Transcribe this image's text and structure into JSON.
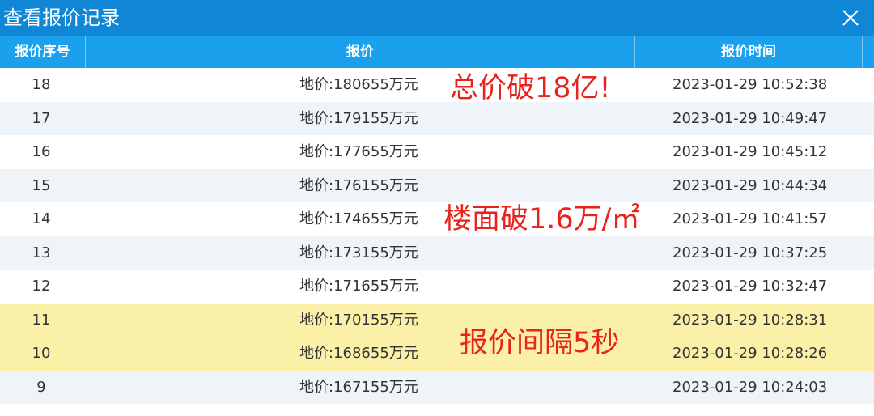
{
  "window": {
    "title": "查看报价记录"
  },
  "table": {
    "headers": {
      "seq": "报价序号",
      "price": "报价",
      "time": "报价时间"
    },
    "rows": [
      {
        "seq": "18",
        "price": "地价:180655万元",
        "time": "2023-01-29 10:52:38"
      },
      {
        "seq": "17",
        "price": "地价:179155万元",
        "time": "2023-01-29 10:49:47"
      },
      {
        "seq": "16",
        "price": "地价:177655万元",
        "time": "2023-01-29 10:45:12"
      },
      {
        "seq": "15",
        "price": "地价:176155万元",
        "time": "2023-01-29 10:44:34"
      },
      {
        "seq": "14",
        "price": "地价:174655万元",
        "time": "2023-01-29 10:41:57"
      },
      {
        "seq": "13",
        "price": "地价:173155万元",
        "time": "2023-01-29 10:37:25"
      },
      {
        "seq": "12",
        "price": "地价:171655万元",
        "time": "2023-01-29 10:32:47"
      },
      {
        "seq": "11",
        "price": "地价:170155万元",
        "time": "2023-01-29 10:28:31"
      },
      {
        "seq": "10",
        "price": "地价:168655万元",
        "time": "2023-01-29 10:28:26"
      },
      {
        "seq": "9",
        "price": "地价:167155万元",
        "time": "2023-01-29 10:24:03"
      }
    ]
  },
  "annotations": {
    "a1": "总价破18亿!",
    "a2": "楼面破1.6万/㎡",
    "a3": "报价间隔5秒"
  },
  "colors": {
    "titlebar": "#0f86d6",
    "header": "#1aa0ec",
    "highlight_row": "#fbf0a8",
    "annotation": "#e8231e"
  },
  "icons": {
    "close": "close-icon"
  }
}
